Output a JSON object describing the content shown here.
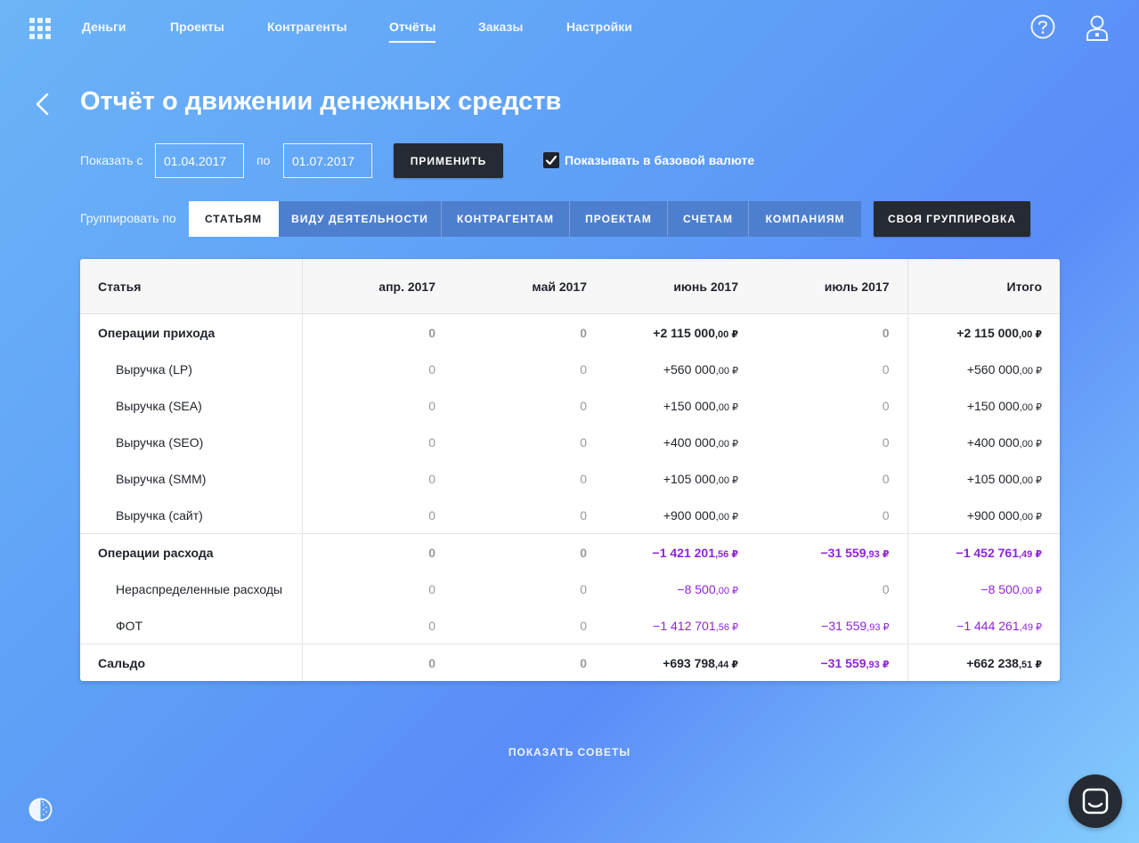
{
  "nav": {
    "items": [
      {
        "label": "Деньги",
        "active": false
      },
      {
        "label": "Проекты",
        "active": false
      },
      {
        "label": "Контрагенты",
        "active": false
      },
      {
        "label": "Отчёты",
        "active": true
      },
      {
        "label": "Заказы",
        "active": false
      },
      {
        "label": "Настройки",
        "active": false
      }
    ]
  },
  "header": {
    "title": "Отчёт о движении денежных средств"
  },
  "filters": {
    "show_from_label": "Показать с",
    "date_from": "01.04.2017",
    "to_label": "по",
    "date_to": "01.07.2017",
    "apply_label": "ПРИМЕНИТЬ",
    "base_currency_label": "Показывать в базовой валюте",
    "base_currency_checked": true
  },
  "grouping": {
    "label": "Группировать по",
    "options": [
      {
        "label": "СТАТЬЯМ",
        "active": true
      },
      {
        "label": "ВИДУ ДЕЯТЕЛЬНОСТИ",
        "active": false
      },
      {
        "label": "КОНТРАГЕНТАМ",
        "active": false
      },
      {
        "label": "ПРОЕКТАМ",
        "active": false
      },
      {
        "label": "СЧЕТАМ",
        "active": false
      },
      {
        "label": "КОМПАНИЯМ",
        "active": false
      }
    ],
    "custom_label": "СВОЯ ГРУППИРОВКА"
  },
  "table": {
    "columns": [
      "Статья",
      "апр. 2017",
      "май 2017",
      "июнь 2017",
      "июль 2017",
      "Итого"
    ],
    "income": {
      "label": "Операции прихода",
      "values": [
        "0",
        "0",
        "+2 115 000",
        "0",
        "+2 115 000"
      ],
      "cents": [
        "",
        "",
        ",00 ₽",
        "",
        ",00 ₽"
      ],
      "rows": [
        {
          "label": "Выручка (LP)",
          "values": [
            "0",
            "0",
            "+560 000",
            "0",
            "+560 000"
          ],
          "cents": [
            "",
            "",
            ",00 ₽",
            "",
            ",00 ₽"
          ]
        },
        {
          "label": "Выручка (SEA)",
          "values": [
            "0",
            "0",
            "+150 000",
            "0",
            "+150 000"
          ],
          "cents": [
            "",
            "",
            ",00 ₽",
            "",
            ",00 ₽"
          ]
        },
        {
          "label": "Выручка (SEO)",
          "values": [
            "0",
            "0",
            "+400 000",
            "0",
            "+400 000"
          ],
          "cents": [
            "",
            "",
            ",00 ₽",
            "",
            ",00 ₽"
          ]
        },
        {
          "label": "Выручка (SMM)",
          "values": [
            "0",
            "0",
            "+105 000",
            "0",
            "+105 000"
          ],
          "cents": [
            "",
            "",
            ",00 ₽",
            "",
            ",00 ₽"
          ]
        },
        {
          "label": "Выручка (сайт)",
          "values": [
            "0",
            "0",
            "+900 000",
            "0",
            "+900 000"
          ],
          "cents": [
            "",
            "",
            ",00 ₽",
            "",
            ",00 ₽"
          ]
        }
      ]
    },
    "expense": {
      "label": "Операции расхода",
      "values": [
        "0",
        "0",
        "−1 421 201",
        "−31 559",
        "−1 452 761"
      ],
      "cents": [
        "",
        "",
        ",56 ₽",
        ",93 ₽",
        ",49 ₽"
      ],
      "rows": [
        {
          "label": "Нераспределенные расходы",
          "values": [
            "0",
            "0",
            "−8 500",
            "0",
            "−8 500"
          ],
          "cents": [
            "",
            "",
            ",00 ₽",
            "",
            ",00 ₽"
          ]
        },
        {
          "label": "ФОТ",
          "values": [
            "0",
            "0",
            "−1 412 701",
            "−31 559",
            "−1 444 261"
          ],
          "cents": [
            "",
            "",
            ",56 ₽",
            ",93 ₽",
            ",49 ₽"
          ]
        }
      ]
    },
    "balance": {
      "label": "Сальдо",
      "values": [
        "0",
        "0",
        "+693 798",
        "−31 559",
        "+662 238"
      ],
      "cents": [
        "",
        "",
        ",44 ₽",
        ",93 ₽",
        ",51 ₽"
      ]
    }
  },
  "footer": {
    "tips_label": "ПОКАЗАТЬ СОВЕТЫ"
  },
  "icons": {
    "apps": "grid-icon",
    "help": "help-icon",
    "user": "user-icon",
    "back": "chevron-left-icon",
    "theme": "theme-icon",
    "chat": "chat-icon"
  },
  "colors": {
    "negative": "#9124d8",
    "zero": "#9a9a9a",
    "dark_button": "#262a33",
    "segment": "#4e7fcf"
  }
}
